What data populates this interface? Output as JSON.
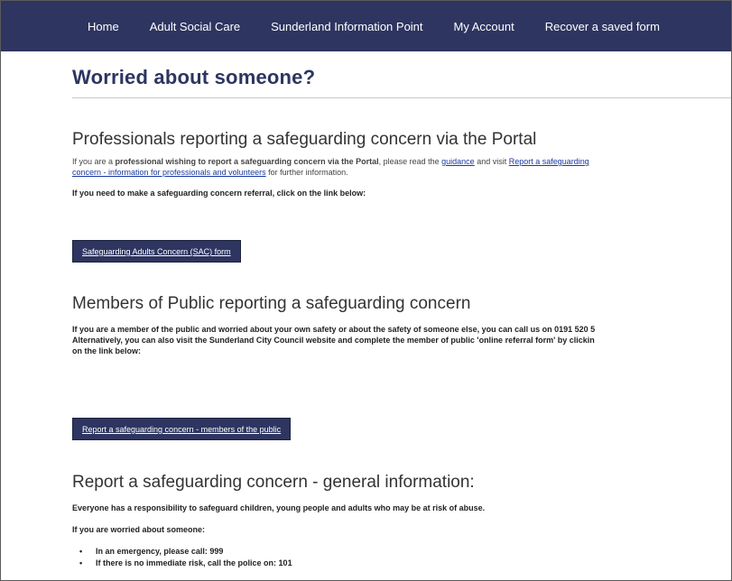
{
  "nav": {
    "items": [
      {
        "label": "Home"
      },
      {
        "label": "Adult Social Care"
      },
      {
        "label": "Sunderland Information Point"
      },
      {
        "label": "My Account"
      },
      {
        "label": "Recover a saved form"
      }
    ]
  },
  "page": {
    "title": "Worried about someone?"
  },
  "professionals": {
    "heading": "Professionals reporting a safeguarding concern via the Portal",
    "intro_prefix": "If you are a ",
    "intro_bold": "professional wishing to report a safeguarding concern via the Portal",
    "intro_mid": ", please read the ",
    "guidance_link": "guidance",
    "intro_and_visit": " and visit ",
    "report_link_part1": "Report a safeguarding",
    "report_link_part2": "concern - information for professionals and volunteers",
    "intro_suffix": " for further information.",
    "referral_prompt": "If you need to make a safeguarding concern referral, click on the link below:",
    "sac_button": "Safeguarding Adults Concern (SAC) form"
  },
  "public": {
    "heading": "Members of Public reporting a safeguarding concern",
    "line1": "If you are a member of the public and worried about your own safety or about the safety of someone else, you can call us on 0191 520 5",
    "line2": "Alternatively, you can also visit the Sunderland City Council website and complete the member of public 'online referral form' by clickin",
    "line3": "on the link below:",
    "public_button": "Report a safeguarding concern - members of the public"
  },
  "general": {
    "heading": "Report a safeguarding concern - general information:",
    "responsibility": "Everyone has a responsibility to safeguard children, young people and adults who may be at risk of abuse.",
    "worried": "If you are worried about someone:",
    "bullets": [
      "In an emergency, please call: 999",
      "If there is no immediate risk, call the police on: 101"
    ]
  }
}
